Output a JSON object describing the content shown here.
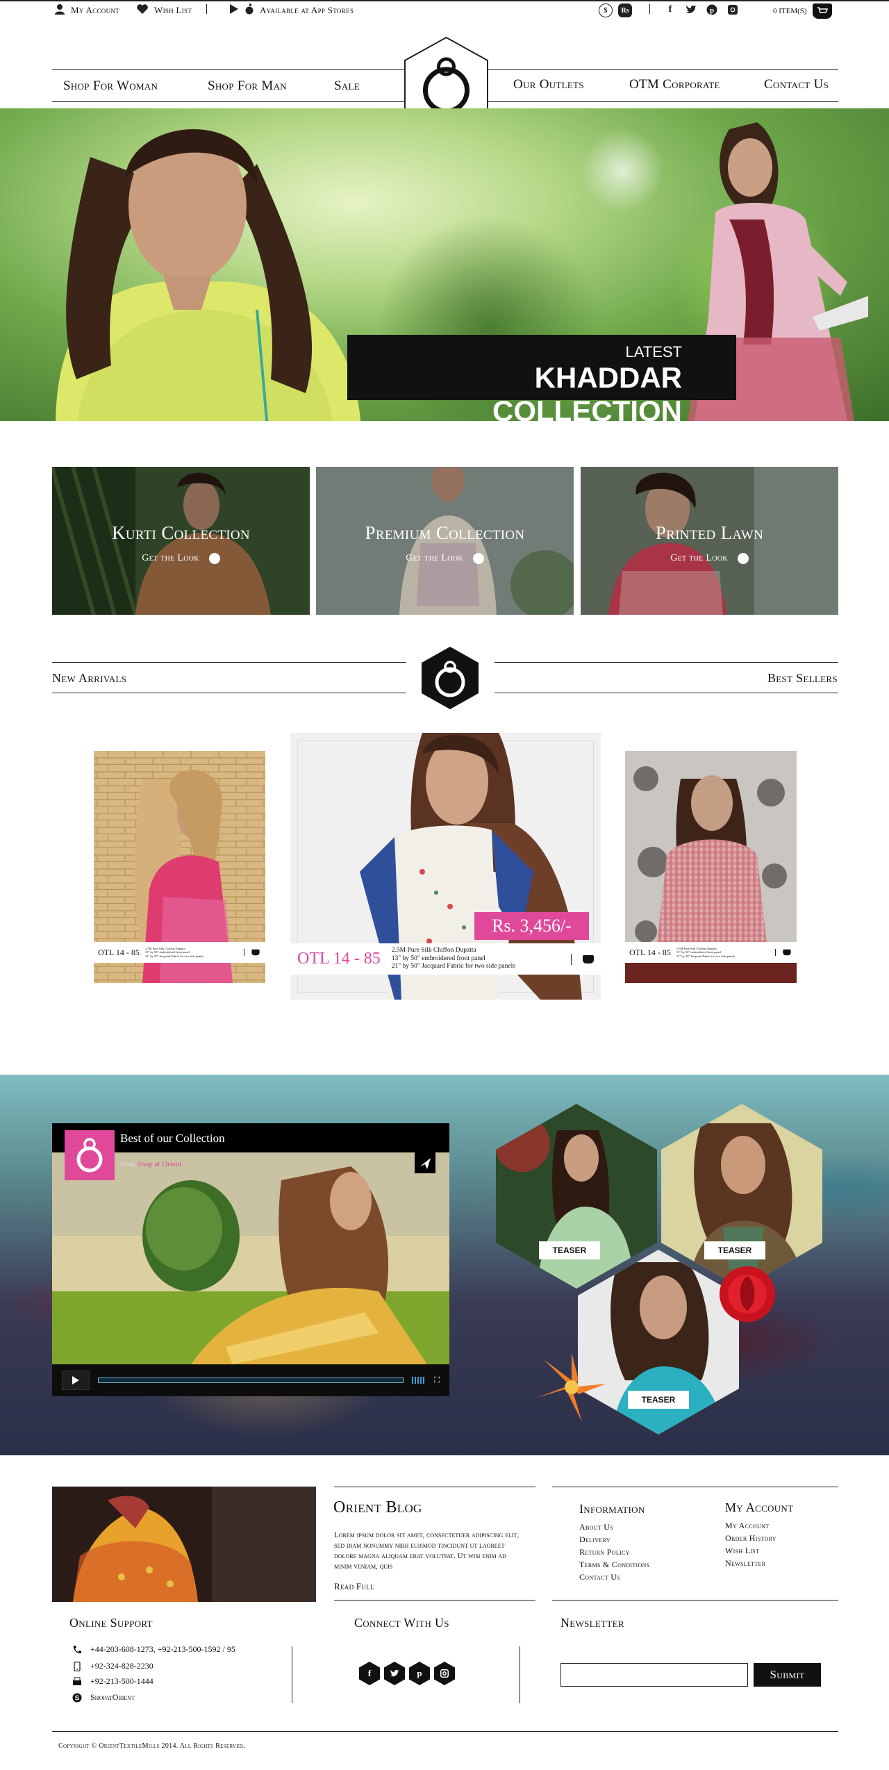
{
  "topbar": {
    "my_account": "My Account",
    "wish_list": "Wish List",
    "app_stores": "Available at App Stores",
    "currency_dollar": "$",
    "currency_rs": "Rs",
    "items": "0 ITEM(S)"
  },
  "nav": {
    "women": "Shop For Woman",
    "men": "Shop For Man",
    "sale": "Sale",
    "outlets": "Our Outlets",
    "corporate": "OTM Corporate",
    "contact": "Contact Us"
  },
  "hero": {
    "latest": "LATEST",
    "title": "KHADDAR COLLECTION"
  },
  "tiles": [
    {
      "title": "Kurti Collection",
      "cta": "Get the Look"
    },
    {
      "title": "Premium Collection",
      "cta": "Get the Look"
    },
    {
      "title": "Printed Lawn",
      "cta": "Get the Look"
    }
  ],
  "sections": {
    "new_arrivals": "New Arrivals",
    "best_sellers": "Best Sellers"
  },
  "products": [
    {
      "code": "OTL 14 - 85",
      "desc": [
        "2.5M Pure Silk Chiffon Dupatta",
        "13\" by 50\" embroidered front panel",
        "21\" by 50\" Jacquard Fabric for two side panels"
      ]
    },
    {
      "code": "OTL 14 - 85",
      "price": "Rs. 3,456/-",
      "desc": [
        "2.5M Pure Silk Chiffon Dupatta",
        "13\" by 50\" embroidered front panel",
        "21\" by 50\" Jacquard Fabric for two side panels"
      ]
    },
    {
      "code": "OTL 14 - 85",
      "desc": [
        "2.5M Pure Silk Chiffon Dupatta",
        "13\" by 50\" embroidered front panel",
        "21\" by 50\" Jacquard Fabric for two side panels"
      ]
    }
  ],
  "video": {
    "title": "Best of our Collection",
    "from": "from",
    "channel": "Shop at Orient",
    "teasers": [
      "TEASER",
      "TEASER",
      "TEASER"
    ]
  },
  "footer": {
    "blog_title": "Orient Blog",
    "blog_text": "Lorem ipsum dolor sit amet, consectetuer adipiscing elit, sed diam nonummy nibh euismod tincidunt ut laoreet dolore magna aliquam erat volutpat. Ut wisi enim ad minim veniam, quis",
    "read_full": "Read Full",
    "info_title": "Information",
    "info_links": [
      "About Us",
      "Delivery",
      "Return Policy",
      "Terms & Conditions",
      "Contact Us"
    ],
    "account_title": "My Account",
    "account_links": [
      "My Account",
      "Order History",
      "Wish List",
      "Newsletter"
    ],
    "support_title": "Online Support",
    "phone": "+44-203-608-1273, +92-213-500-1592 / 95",
    "mobile": "+92-324-828-2230",
    "fax": "+92-213-500-1444",
    "skype": "ShopatOrient",
    "connect_title": "Connect With Us",
    "newsletter_title": "Newsletter",
    "newsletter_placeholder": "",
    "submit": "Submit",
    "copyright": "Copyright © OrientTextileMills 2014. All Rights Reserved."
  }
}
